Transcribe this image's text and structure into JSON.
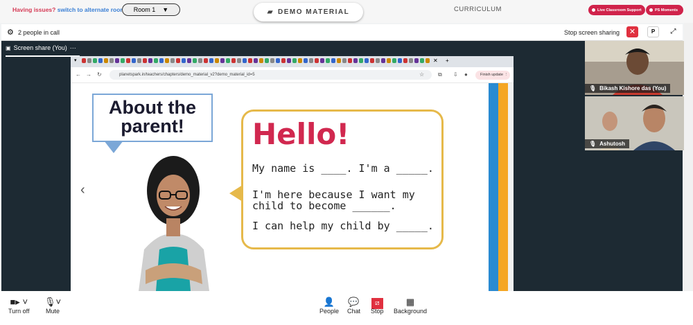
{
  "top": {
    "issue_question": "Having issues?",
    "issue_link": "switch to alternate room",
    "room_label": "Room 1",
    "demo_label": "DEMO MATERIAL",
    "curriculum_label": "CURRICULUM",
    "support_label": "Live Classroom Support",
    "moments_label": "PS Moments",
    "accent": "#d0234b"
  },
  "call": {
    "people_count": "2 people in call",
    "stop_share_label": "Stop screen sharing",
    "p_label": "P"
  },
  "screen_share": {
    "label": "Screen share (You)",
    "more": "···"
  },
  "browser": {
    "url": "planetspark.in/teachers/chapters/demo_material_v2?demo_material_id=5",
    "finish_label": "Finish update"
  },
  "slide": {
    "about_title": "About the parent!",
    "hello": "Hello!",
    "line1": "My name is ____. I'm a _____.",
    "line2": "I'm here because I want my child to become ______.",
    "line3": "I can help my child by _____."
  },
  "participants": [
    {
      "name": "Bikash Kishore das (You)"
    },
    {
      "name": "Ashutosh"
    }
  ],
  "controls": {
    "turn_off": "Turn off",
    "mute": "Mute",
    "people": "People",
    "chat": "Chat",
    "stop": "Stop",
    "background": "Background"
  }
}
